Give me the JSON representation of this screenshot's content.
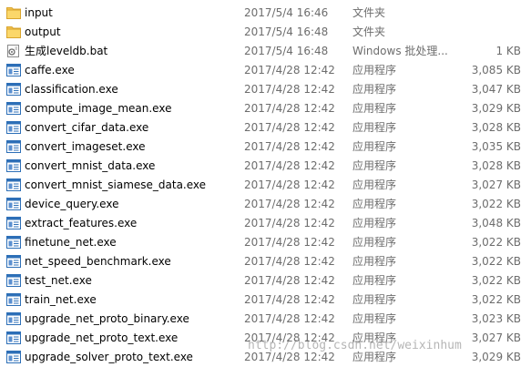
{
  "colors": {
    "folder": "#f3c24f",
    "exe_frame": "#2d6fb7",
    "text_secondary": "#6d6d6d"
  },
  "files": [
    {
      "name": "input",
      "date": "2017/5/4 16:46",
      "type": "文件夹",
      "size": "",
      "icon": "folder-icon"
    },
    {
      "name": "output",
      "date": "2017/5/4 16:48",
      "type": "文件夹",
      "size": "",
      "icon": "folder-icon"
    },
    {
      "name": "生成leveldb.bat",
      "date": "2017/5/4 16:48",
      "type": "Windows 批处理...",
      "size": "1 KB",
      "icon": "batch-file-icon"
    },
    {
      "name": "caffe.exe",
      "date": "2017/4/28 12:42",
      "type": "应用程序",
      "size": "3,085 KB",
      "icon": "application-icon"
    },
    {
      "name": "classification.exe",
      "date": "2017/4/28 12:42",
      "type": "应用程序",
      "size": "3,047 KB",
      "icon": "application-icon"
    },
    {
      "name": "compute_image_mean.exe",
      "date": "2017/4/28 12:42",
      "type": "应用程序",
      "size": "3,029 KB",
      "icon": "application-icon"
    },
    {
      "name": "convert_cifar_data.exe",
      "date": "2017/4/28 12:42",
      "type": "应用程序",
      "size": "3,028 KB",
      "icon": "application-icon"
    },
    {
      "name": "convert_imageset.exe",
      "date": "2017/4/28 12:42",
      "type": "应用程序",
      "size": "3,035 KB",
      "icon": "application-icon"
    },
    {
      "name": "convert_mnist_data.exe",
      "date": "2017/4/28 12:42",
      "type": "应用程序",
      "size": "3,028 KB",
      "icon": "application-icon"
    },
    {
      "name": "convert_mnist_siamese_data.exe",
      "date": "2017/4/28 12:42",
      "type": "应用程序",
      "size": "3,027 KB",
      "icon": "application-icon"
    },
    {
      "name": "device_query.exe",
      "date": "2017/4/28 12:42",
      "type": "应用程序",
      "size": "3,022 KB",
      "icon": "application-icon"
    },
    {
      "name": "extract_features.exe",
      "date": "2017/4/28 12:42",
      "type": "应用程序",
      "size": "3,048 KB",
      "icon": "application-icon"
    },
    {
      "name": "finetune_net.exe",
      "date": "2017/4/28 12:42",
      "type": "应用程序",
      "size": "3,022 KB",
      "icon": "application-icon"
    },
    {
      "name": "net_speed_benchmark.exe",
      "date": "2017/4/28 12:42",
      "type": "应用程序",
      "size": "3,022 KB",
      "icon": "application-icon"
    },
    {
      "name": "test_net.exe",
      "date": "2017/4/28 12:42",
      "type": "应用程序",
      "size": "3,022 KB",
      "icon": "application-icon"
    },
    {
      "name": "train_net.exe",
      "date": "2017/4/28 12:42",
      "type": "应用程序",
      "size": "3,022 KB",
      "icon": "application-icon"
    },
    {
      "name": "upgrade_net_proto_binary.exe",
      "date": "2017/4/28 12:42",
      "type": "应用程序",
      "size": "3,023 KB",
      "icon": "application-icon"
    },
    {
      "name": "upgrade_net_proto_text.exe",
      "date": "2017/4/28 12:42",
      "type": "应用程序",
      "size": "3,027 KB",
      "icon": "application-icon"
    },
    {
      "name": "upgrade_solver_proto_text.exe",
      "date": "2017/4/28 12:42",
      "type": "应用程序",
      "size": "3,029 KB",
      "icon": "application-icon"
    }
  ],
  "watermark": "http://blog.csdn.net/weixinhum"
}
